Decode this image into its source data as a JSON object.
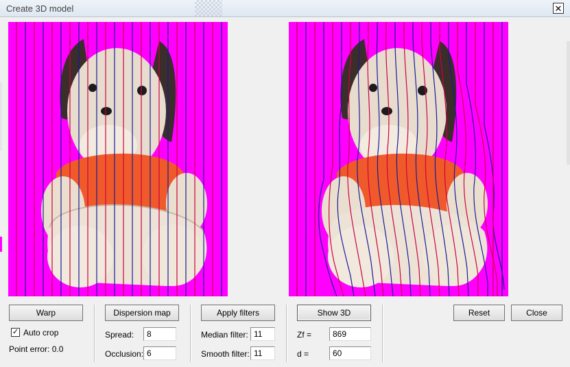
{
  "window": {
    "title": "Create 3D model",
    "close_glyph": "✕"
  },
  "images": {
    "left": {
      "background": "#ff00ff",
      "line_colors": [
        "#cc0044",
        "#1a1a9a"
      ]
    },
    "right": {
      "background": "#ff00ff",
      "line_colors": [
        "#cc0044",
        "#1a1a9a"
      ]
    }
  },
  "controls": {
    "warp_label": "Warp",
    "auto_crop_label": "Auto crop",
    "auto_crop_checked": true,
    "auto_crop_check_glyph": "✓",
    "point_error_label": "Point error: 0.0",
    "dispersion_map_label": "Dispersion map",
    "spread_label": "Spread:",
    "spread_value": "8",
    "occlusion_label": "Occlusion:",
    "occlusion_value": "6",
    "apply_filters_label": "Apply filters",
    "median_filter_label": "Median filter:",
    "median_filter_value": "11",
    "smooth_filter_label": "Smooth filter:",
    "smooth_filter_value": "11",
    "show_3d_label": "Show 3D",
    "zf_label": "Zf =",
    "zf_value": "869",
    "d_label": "d =",
    "d_value": "60",
    "reset_label": "Reset",
    "close_label": "Close"
  }
}
